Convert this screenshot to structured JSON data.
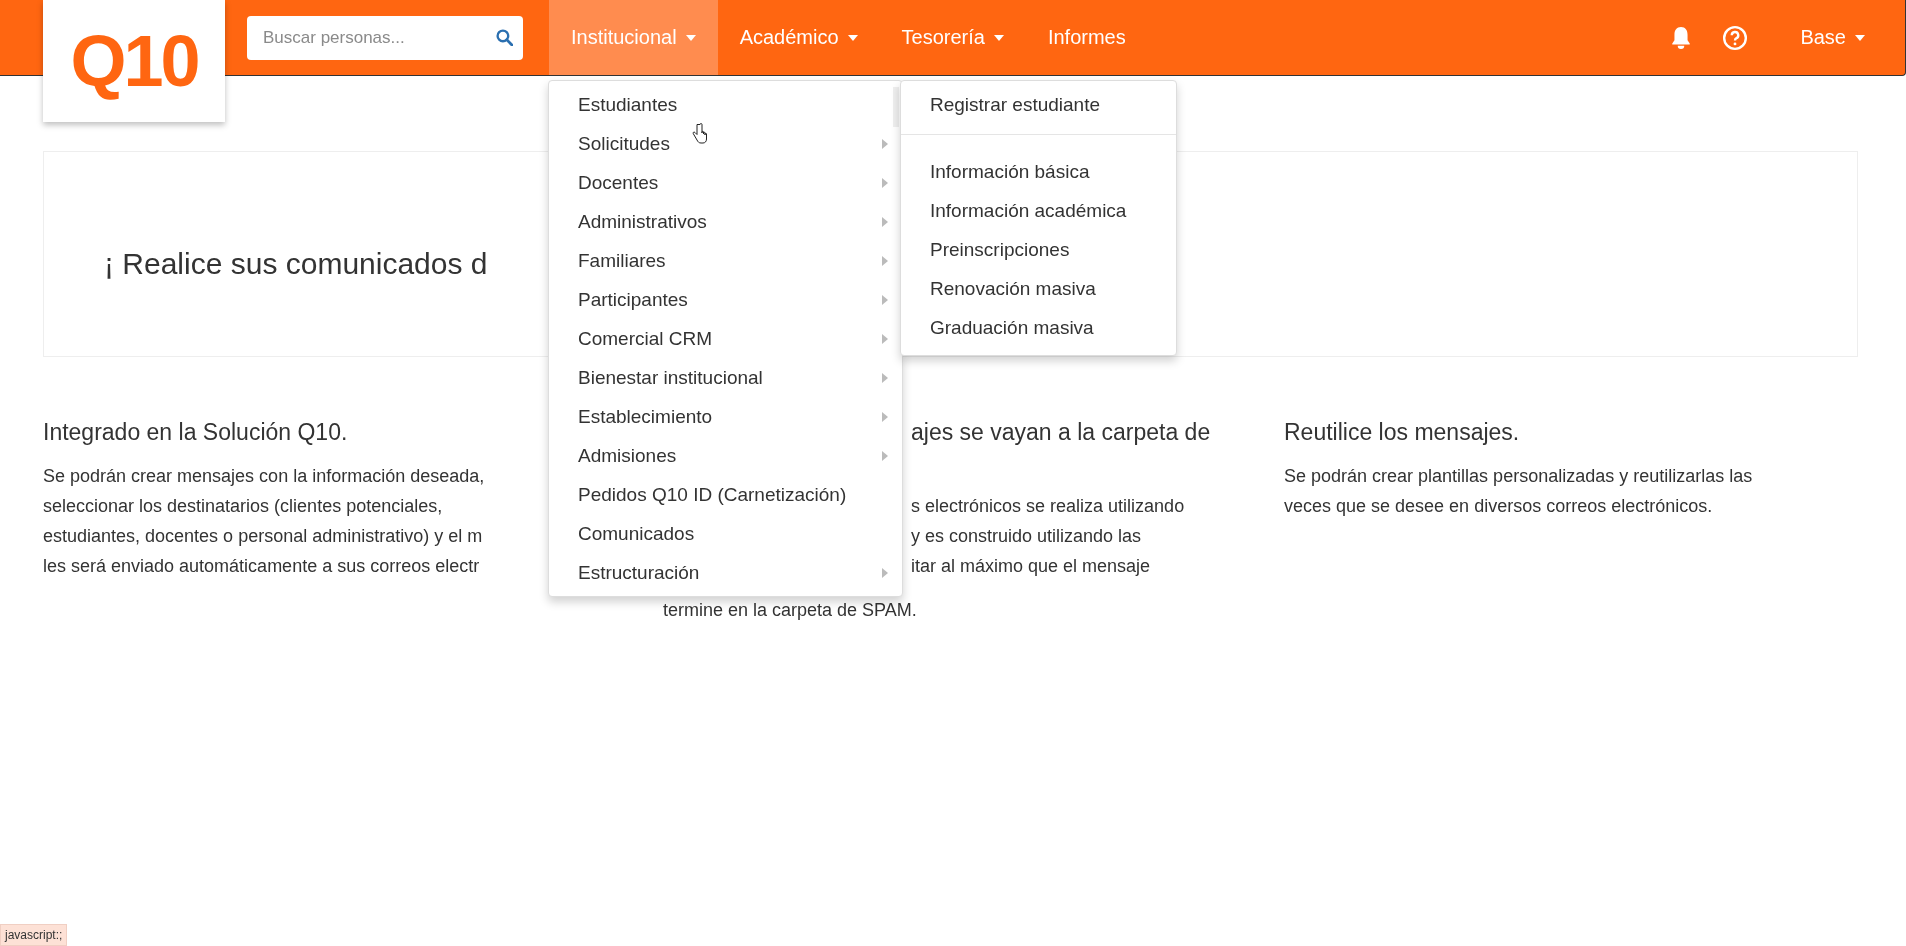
{
  "logo": "Q10",
  "search": {
    "placeholder": "Buscar personas..."
  },
  "nav": [
    {
      "label": "Institucional",
      "caret": true,
      "selected": true
    },
    {
      "label": "Académico",
      "caret": true,
      "selected": false
    },
    {
      "label": "Tesorería",
      "caret": true,
      "selected": false
    },
    {
      "label": "Informes",
      "caret": false,
      "selected": false
    }
  ],
  "user_menu": {
    "label": "Base"
  },
  "hero": {
    "title": "¡ Realice sus comunicados d"
  },
  "columns": [
    {
      "heading": "Integrado en la Solución Q10.",
      "lines": [
        "Se podrán crear mensajes con la información deseada,",
        "seleccionar los destinatarios (clientes potenciales,",
        "estudiantes, docentes o personal administrativo) y el m",
        "les será enviado automáticamente a sus correos electr"
      ]
    },
    {
      "heading": "ajes se vayan a la carpeta de",
      "lines": [
        "s electrónicos se realiza utilizando",
        "y es construido utilizando las",
        "itar al máximo que el mensaje",
        "termine en la carpeta de SPAM."
      ]
    },
    {
      "heading": "Reutilice los mensajes.",
      "lines": [
        "Se podrán crear plantillas personalizadas y reutilizarlas las",
        "veces que se desee en diversos correos electrónicos."
      ]
    }
  ],
  "dropdown": [
    {
      "label": "Estudiantes",
      "submenu": false
    },
    {
      "label": "Solicitudes",
      "submenu": true
    },
    {
      "label": "Docentes",
      "submenu": true
    },
    {
      "label": "Administrativos",
      "submenu": true
    },
    {
      "label": "Familiares",
      "submenu": true
    },
    {
      "label": "Participantes",
      "submenu": true
    },
    {
      "label": "Comercial CRM",
      "submenu": true
    },
    {
      "label": "Bienestar institucional",
      "submenu": true
    },
    {
      "label": "Establecimiento",
      "submenu": true
    },
    {
      "label": "Admisiones",
      "submenu": true
    },
    {
      "label": "Pedidos Q10 ID (Carnetización)",
      "submenu": false
    },
    {
      "label": "Comunicados",
      "submenu": false
    },
    {
      "label": "Estructuración",
      "submenu": true
    }
  ],
  "submenu": [
    {
      "label": "Registrar estudiante",
      "divider_after": true
    },
    {
      "label": "Información básica",
      "divider_after": false
    },
    {
      "label": "Información académica",
      "divider_after": false
    },
    {
      "label": "Preinscripciones",
      "divider_after": false
    },
    {
      "label": "Renovación masiva",
      "divider_after": false
    },
    {
      "label": "Graduación masiva",
      "divider_after": false
    }
  ],
  "status_bar": {
    "text": "javascript:;"
  }
}
